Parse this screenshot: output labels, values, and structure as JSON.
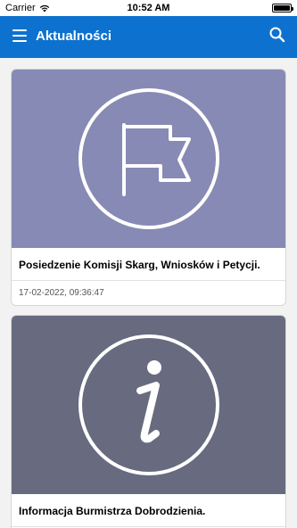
{
  "status_bar": {
    "carrier": "Carrier",
    "time": "10:52 AM"
  },
  "app_bar": {
    "title": "Aktualności",
    "menu_icon": "hamburger-icon",
    "search_icon": "search-icon"
  },
  "news": [
    {
      "headline": "Posiedzenie Komisji Skarg, Wniosków i Petycji.",
      "date": "17-02-2022, 09:36:47",
      "icon": "flag-icon",
      "bg_color": "#878ab4"
    },
    {
      "headline": "Informacja Burmistrza Dobrodzienia.",
      "date": "",
      "icon": "info-icon",
      "bg_color": "#686a7f"
    }
  ],
  "colors": {
    "app_bar": "#0d72cf",
    "background": "#f2f2f2"
  }
}
